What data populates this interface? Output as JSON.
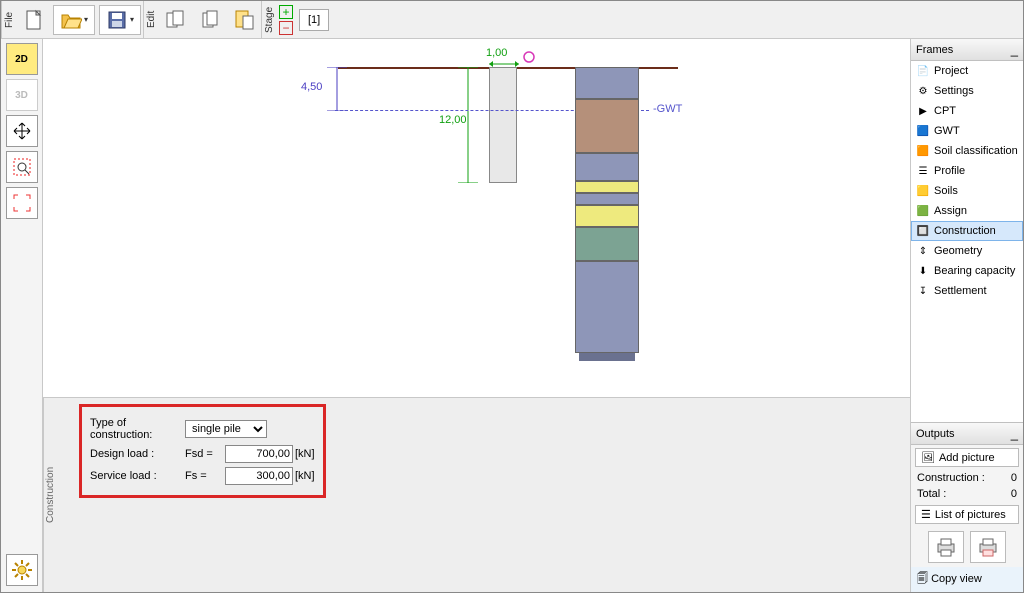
{
  "topbar": {
    "file_label": "File",
    "edit_label": "Edit",
    "stage_label": "Stage",
    "stage_tab": "[1]"
  },
  "leftbar": {
    "btn_2d": "2D",
    "btn_3d": "3D"
  },
  "canvas": {
    "dim_top": "1,00",
    "dim_water": "4,50",
    "dim_pile": "12,00",
    "gwt_label": "-GWT"
  },
  "frames": {
    "title": "Frames",
    "items": [
      {
        "label": "Project",
        "icon": "📄"
      },
      {
        "label": "Settings",
        "icon": "⚙"
      },
      {
        "label": "CPT",
        "icon": "▶"
      },
      {
        "label": "GWT",
        "icon": "🟦"
      },
      {
        "label": "Soil classification",
        "icon": "🟧"
      },
      {
        "label": "Profile",
        "icon": "☰"
      },
      {
        "label": "Soils",
        "icon": "🟨"
      },
      {
        "label": "Assign",
        "icon": "🟩"
      },
      {
        "label": "Construction",
        "icon": "🔲"
      },
      {
        "label": "Geometry",
        "icon": "⇕"
      },
      {
        "label": "Bearing capacity",
        "icon": "⬇"
      },
      {
        "label": "Settlement",
        "icon": "↧"
      }
    ]
  },
  "inputs": {
    "type_label": "Type of construction:",
    "type_value": "single pile",
    "design_label": "Design load :",
    "design_var": "Fsd =",
    "design_value": "700,00",
    "design_unit": "[kN]",
    "service_label": "Service load :",
    "service_var": "Fs =",
    "service_value": "300,00",
    "service_unit": "[kN]",
    "tab_label": "Construction"
  },
  "outputs": {
    "title": "Outputs",
    "add_picture": "Add picture",
    "construction_label": "Construction :",
    "construction_val": "0",
    "total_label": "Total :",
    "total_val": "0",
    "list": "List of pictures",
    "copy": "Copy view"
  }
}
